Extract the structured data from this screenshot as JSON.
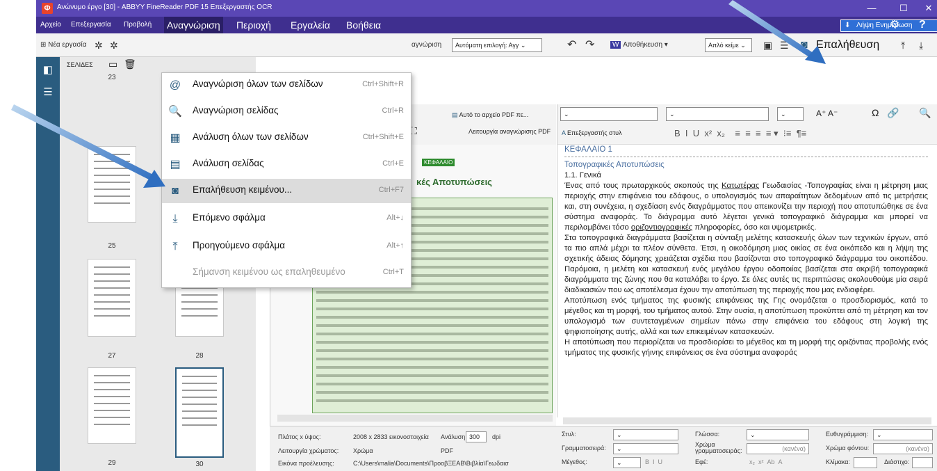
{
  "window": {
    "title": "Ανώνυμο έργο [30] - ABBYY FineReader PDF 15 Επεξεργαστής OCR",
    "controls": [
      "—",
      "☐",
      "✕"
    ]
  },
  "menubar": {
    "items_small": [
      "Αρχείο",
      "Επεξεργασία",
      "Προβολή"
    ],
    "active": "Αναγνώριση",
    "items_big": [
      "Περιοχή",
      "Εργαλεία",
      "Βοήθεια"
    ],
    "update_label": "Λήψη Ενημέρωση"
  },
  "toolbar": {
    "new_task": "Νέα εργασία",
    "recognize_label": "αγνώριση",
    "lang_dropdown": "Αυτόματη επιλογή: Αγγ",
    "save_label": "Αποθήκευση",
    "format_dropdown": "Απλό κείμε",
    "verify_label": "Επαλήθευση"
  },
  "thumbs": {
    "header": "ΣΕΛΙΔΕΣ",
    "pages": [
      "23",
      "25",
      "27",
      "28",
      "29",
      "30"
    ]
  },
  "image_pane": {
    "to_pdf": "Αυτό το αρχείο PDF πε...",
    "mode": "Λειτουργία αναγνώρισης PDF",
    "heading": "κές Αποτυπώσεις",
    "chapter_tag": "ΚΕΦΑΛΑΙΟ"
  },
  "format_bar": {
    "style_editor": "Επεξεργαστής στυλ"
  },
  "menu": {
    "items": [
      {
        "label": "Αναγνώριση όλων των σελίδων",
        "shortcut": "Ctrl+Shift+R",
        "icon": "@"
      },
      {
        "label": "Αναγνώριση σελίδας",
        "shortcut": "Ctrl+R",
        "icon": "🔍"
      },
      {
        "label": "Ανάλυση όλων των σελίδων",
        "shortcut": "Ctrl+Shift+E",
        "icon": "▦"
      },
      {
        "label": "Ανάλυση σελίδας",
        "shortcut": "Ctrl+E",
        "icon": "▤"
      },
      {
        "label": "Επαλήθευση κειμένου...",
        "shortcut": "Ctrl+F7",
        "icon": "◙"
      },
      {
        "label": "Επόμενο σφάλμα",
        "shortcut": "Alt+↓",
        "icon": "⤓"
      },
      {
        "label": "Προηγούμενο σφάλμα",
        "shortcut": "Alt+↑",
        "icon": "⤒"
      },
      {
        "label": "Σήμανση κειμένου ως επαληθευμένο",
        "shortcut": "Ctrl+T",
        "icon": ""
      }
    ]
  },
  "text": {
    "chapter": "ΚΕΦΑΛΑΙΟ 1",
    "section": "Τοπογραφικές Αποτυπώσεις",
    "sub": "1.1. Γενικά",
    "p1a": "Ένας από τους πρωταρχικούς σκοπούς της ",
    "p1u": "Κατωτέρας",
    "p1b": " Γεωδαισίας -Τοπογραφίας είναι η μέτρηση μιας περιοχής στην επιφάνεια του εδάφους, ο υπολογισμός των απαραίτητων δεδομένων από τις μετρήσεις και, στη συνέχεια, η σχεδίαση ενός διαγράμματος που απεικονίζει την περιοχή που αποτυπώθηκε σε ένα σύστημα αναφοράς. Το διάγραμμα αυτό λέγεται γενικά τοπογραφικό διάγραμμα και μπορεί να περιλαμβάνει τόσο ",
    "p1u2": "οριζοντιογραφικές",
    "p1c": " πληροφορίες, όσο και υψομετρικές.",
    "p2": "Στα τοπογραφικά διαγράμματα βασίζεται η σύνταξη μελέτης κατασκευής όλων των τεχνικών έργων, από τα πιο απλά μέχρι τα πλέον σύνθετα. Έτσι, η οικοδόμηση μιας οικίας σε ένα οικόπεδο και η λήψη της σχετικής άδειας δόμησης χρειάζεται σχέδια που βασίζονται στο τοπογραφικό διάγραμμα του οικοπέδου. Παρόμοια, η μελέτη και κατασκευή ενός μεγάλου έργου οδοποιίας βασίζεται στα ακριβή τοπογραφικά διαγράμματα της ζώνης που θα καταλάβει το έργο. Σε όλες αυτές τις περιπτώσεις ακολουθούμε μία σειρά διαδικασιών που ως αποτέλεσμα έχουν την αποτύπωση της περιοχής που μας ενδιαφέρει.",
    "p3": "Αποτύπωση ενός τμήματος της φυσικής επιφάνειας της Γης ονομάζεται ο προσδιορισμός, κατά το μέγεθος και τη μορφή, του τμήματος αυτού. Στην ουσία, η αποτύπωση προκύπτει από τη μέτρηση και τον υπολογισμό των συντεταγμένων σημείων πάνω στην επιφάνεια του εδάφους στη λογική της ψηφιοποίησης αυτής, αλλά και των επικειμένων κατασκευών.",
    "p4": "Η αποτύπωση που περιορίζεται να προσδιορίσει το μέγεθος και τη μορφή της οριζόντιας προβολής ενός τμήματος της φυσικής γήινης επιφάνειας σε ένα σύστημα αναφοράς"
  },
  "props": {
    "size_label": "Πλάτος x ύψος:",
    "size_value": "2008 x 2833 εικονοστοιχεία",
    "res_label": "Ανάλυση:",
    "res_value": "300",
    "res_unit": "dpi",
    "color_label": "Λειτουργία χρώματος:",
    "color_value": "Χρώμα",
    "src_value": "PDF",
    "origin_label": "Εικόνα προέλευσης:",
    "origin_value": "C:\\Users\\malia\\Documents\\ΠροοβΞΕΑΒ\\Βιβλία\\Γεωδαισ",
    "style_label": "Στυλ:",
    "font_label": "Γραμματοσειρά:",
    "size2_label": "Μέγεθος:",
    "lang_label": "Γλώσσα:",
    "fcolor_label": "Χρώμα γραμματοσειράς:",
    "fcolor_value": "(κανένα)",
    "effects_label": "Εφέ:",
    "align_label": "Ευθυγράμμιση:",
    "bg_label": "Χρώμα φόντου:",
    "bg_value": "(κανένα)",
    "scale_label": "Κλίμακα:",
    "spacing_label": "Διάστιχο:"
  }
}
